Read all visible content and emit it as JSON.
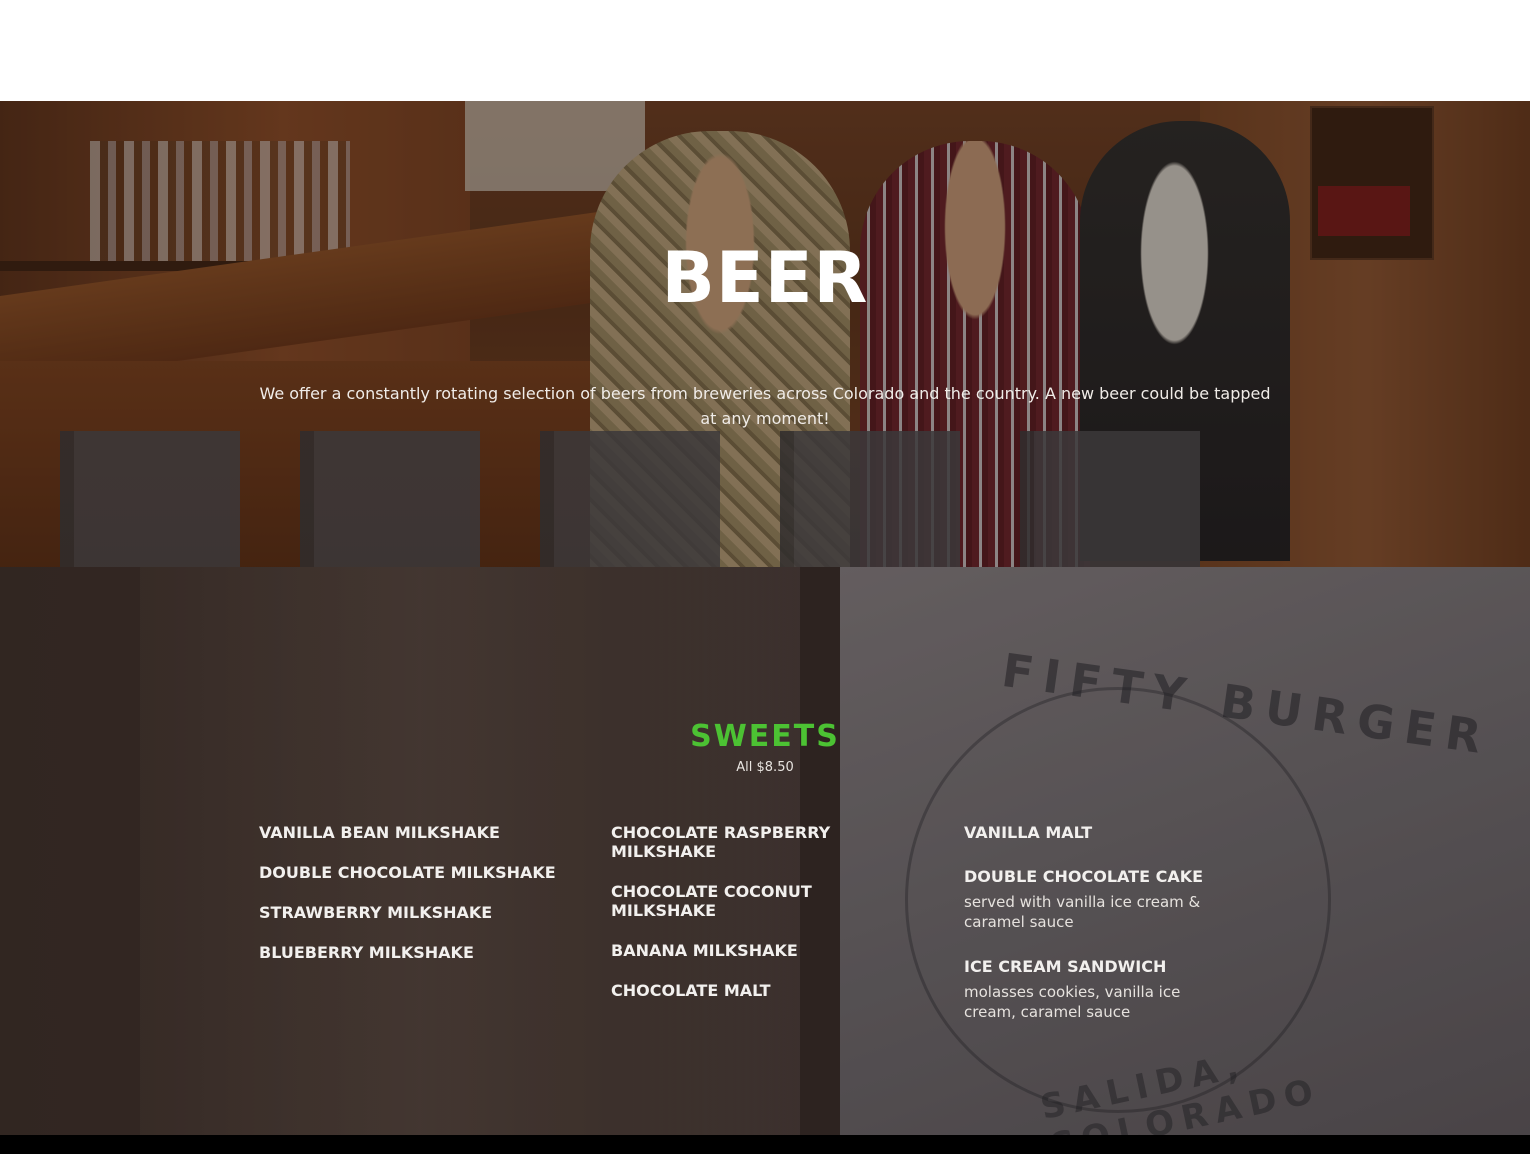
{
  "beer": {
    "title": "BEER",
    "description": "We offer a constantly rotating selection of beers from breweries across Colorado and the country.  A new beer could be tapped at any moment!"
  },
  "sweets": {
    "title": "SWEETS",
    "price": "All $8.50",
    "columns": [
      [
        {
          "name": "VANILLA BEAN MILKSHAKE"
        },
        {
          "name": "DOUBLE CHOCOLATE MILKSHAKE"
        },
        {
          "name": "STRAWBERRY MILKSHAKE"
        },
        {
          "name": "BLUEBERRY MILKSHAKE"
        }
      ],
      [
        {
          "name": "CHOCOLATE RASPBERRY MILKSHAKE"
        },
        {
          "name": "CHOCOLATE COCONUT MILKSHAKE"
        },
        {
          "name": "BANANA MILKSHAKE"
        },
        {
          "name": "CHOCOLATE MALT"
        }
      ],
      [
        {
          "name": "VANILLA MALT"
        },
        {
          "name": "DOUBLE CHOCOLATE CAKE",
          "desc": "served with vanilla ice cream & caramel sauce"
        },
        {
          "name": "ICE CREAM SANDWICH",
          "desc": "molasses cookies, vanilla ice cream, caramel sauce"
        }
      ]
    ],
    "background_logo": {
      "top_text": "FIFTY BURGER",
      "bottom_text": "SALIDA, COLORADO"
    }
  },
  "colors": {
    "sweets_title": "#4cc233",
    "footer": "#000000"
  }
}
